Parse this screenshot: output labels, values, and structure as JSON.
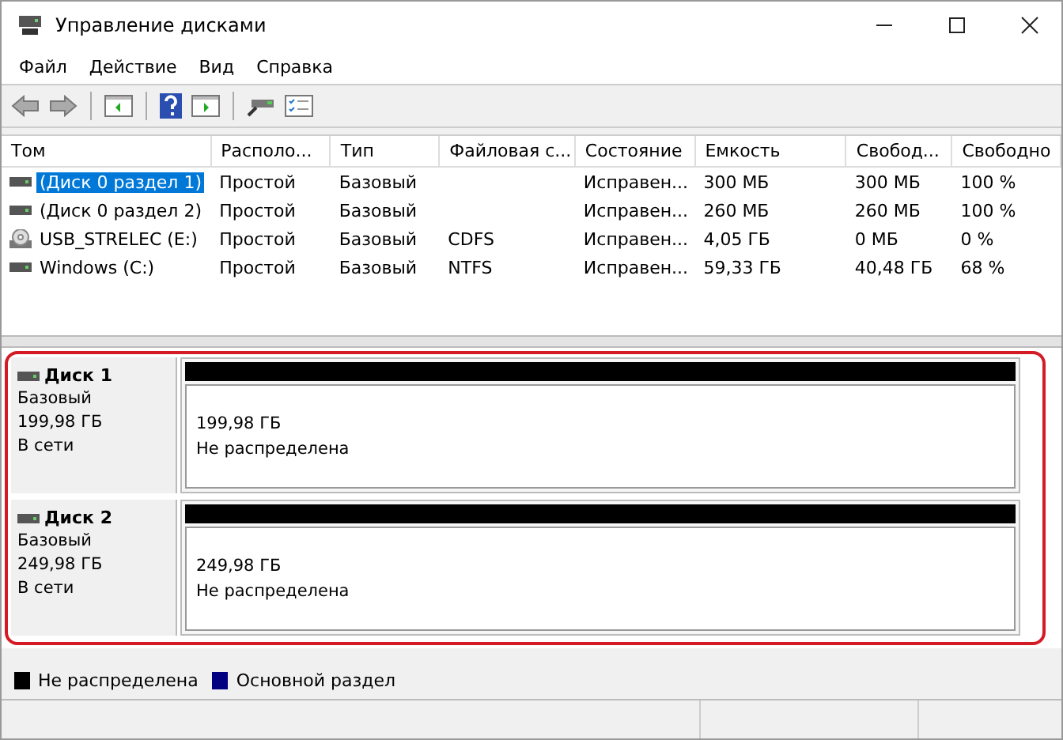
{
  "window": {
    "title": "Управление дисками"
  },
  "menu": [
    "Файл",
    "Действие",
    "Вид",
    "Справка"
  ],
  "table": {
    "columns": [
      "Том",
      "Располо...",
      "Тип",
      "Файловая с...",
      "Состояние",
      "Емкость",
      "Свобод...",
      "Свободно"
    ],
    "rows": [
      {
        "kind": "disk",
        "selected": true,
        "cells": [
          "(Диск 0 раздел 1)",
          "Простой",
          "Базовый",
          "",
          "Исправен...",
          "300 МБ",
          "300 МБ",
          "100 %"
        ]
      },
      {
        "kind": "disk",
        "selected": false,
        "cells": [
          "(Диск 0 раздел 2)",
          "Простой",
          "Базовый",
          "",
          "Исправен...",
          "260 МБ",
          "260 МБ",
          "100 %"
        ]
      },
      {
        "kind": "cd",
        "selected": false,
        "cells": [
          "USB_STRELEC (E:)",
          "Простой",
          "Базовый",
          "CDFS",
          "Исправен...",
          "4,05 ГБ",
          "0 МБ",
          "0 %"
        ]
      },
      {
        "kind": "disk",
        "selected": false,
        "cells": [
          "Windows (C:)",
          "Простой",
          "Базовый",
          "NTFS",
          "Исправен...",
          "59,33 ГБ",
          "40,48 ГБ",
          "68 %"
        ]
      }
    ]
  },
  "disks": [
    {
      "name": "Диск 1",
      "type": "Базовый",
      "size": "199,98 ГБ",
      "status": "В сети",
      "partition": {
        "size": "199,98 ГБ",
        "label": "Не распределена",
        "color": "#000000"
      }
    },
    {
      "name": "Диск 2",
      "type": "Базовый",
      "size": "249,98 ГБ",
      "status": "В сети",
      "partition": {
        "size": "249,98 ГБ",
        "label": "Не распределена",
        "color": "#000000"
      }
    }
  ],
  "legend": [
    {
      "label": "Не распределена",
      "color": "#000000"
    },
    {
      "label": "Основной раздел",
      "color": "#000080"
    }
  ]
}
